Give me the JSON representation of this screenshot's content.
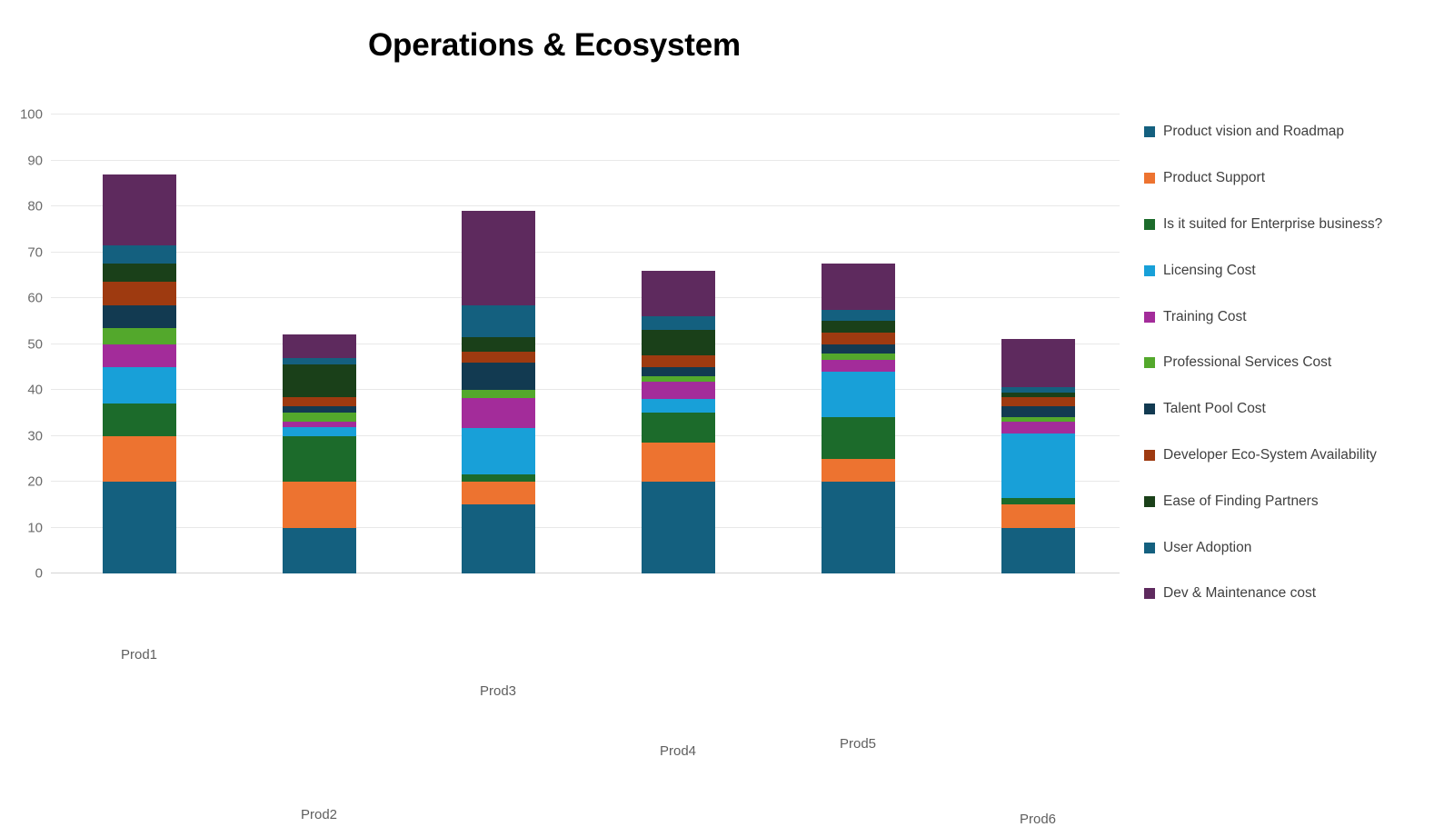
{
  "chart_data": {
    "type": "bar",
    "stacked": true,
    "title": "Operations & Ecosystem",
    "xlabel": "",
    "ylabel": "",
    "ylim": [
      0,
      100
    ],
    "yticks": [
      0,
      10,
      20,
      30,
      40,
      50,
      60,
      70,
      80,
      90,
      100
    ],
    "grid": true,
    "legend_position": "right",
    "categories": [
      "Prod1",
      "Prod2",
      "Prod3",
      "Prod4",
      "Prod5",
      "Prod6"
    ],
    "series": [
      {
        "name": "Product vision and Roadmap",
        "color": "#14607F",
        "values": [
          20,
          10,
          15,
          20,
          20,
          10
        ]
      },
      {
        "name": "Product Support",
        "color": "#ED7330",
        "values": [
          10,
          10,
          5,
          8.5,
          5,
          5
        ]
      },
      {
        "name": "Is it suited for Enterprise business?",
        "color": "#1C6B2B",
        "values": [
          7,
          10,
          1.5,
          6.5,
          9,
          1.5
        ]
      },
      {
        "name": "Licensing Cost",
        "color": "#18A0D8",
        "values": [
          8,
          1.8,
          10.2,
          3,
          10,
          14
        ]
      },
      {
        "name": "Training Cost",
        "color": "#A32C9A",
        "values": [
          5,
          1.2,
          6.6,
          3.8,
          2.5,
          2.5
        ]
      },
      {
        "name": "Professional Services Cost",
        "color": "#53A82C",
        "values": [
          3.5,
          2,
          1.7,
          1.2,
          1.5,
          1
        ]
      },
      {
        "name": "Talent Pool Cost",
        "color": "#123A51",
        "values": [
          5,
          1.5,
          6,
          2,
          2,
          2.5
        ]
      },
      {
        "name": "Developer Eco-System Availability",
        "color": "#9E3A10",
        "values": [
          5,
          2,
          2.3,
          2.5,
          2.5,
          2
        ]
      },
      {
        "name": "Ease of Finding Partners",
        "color": "#1A4019",
        "values": [
          4,
          7,
          3.2,
          5.5,
          2.5,
          1
        ]
      },
      {
        "name": "User Adoption",
        "color": "#14607F",
        "values": [
          4,
          1.5,
          7,
          3,
          2.5,
          1
        ]
      },
      {
        "name": "Dev & Maintenance cost",
        "color": "#5E2A5E",
        "values": [
          15.5,
          5,
          20.5,
          10,
          10,
          10.5
        ]
      }
    ],
    "totals": [
      87,
      52,
      79.5,
      66,
      65.5,
      52
    ]
  }
}
